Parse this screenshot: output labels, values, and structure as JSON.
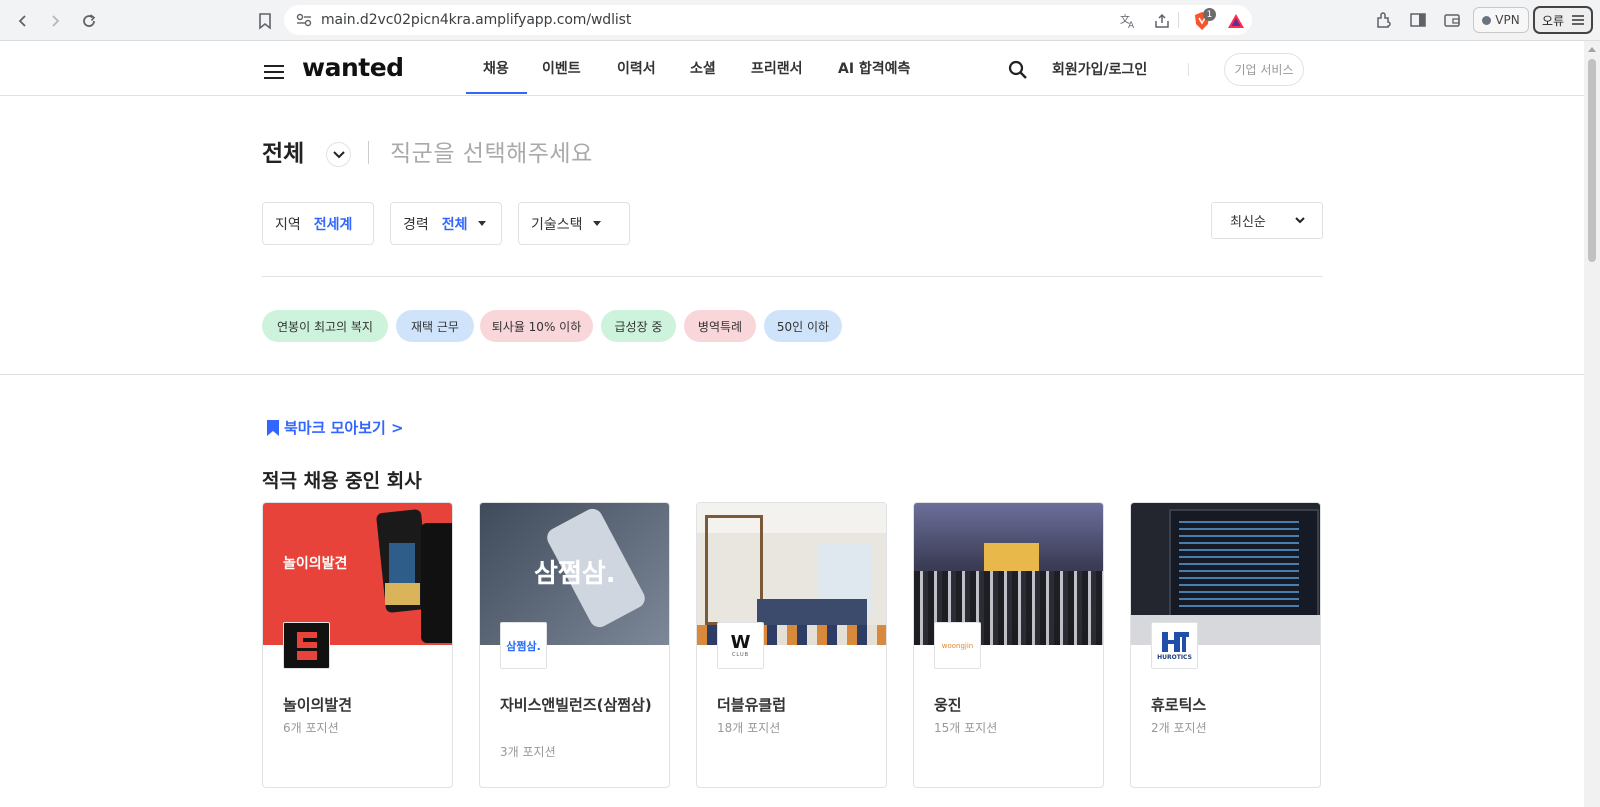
{
  "browser": {
    "url": "main.d2vc02picn4kra.amplifyapp.com/wdlist",
    "vpn_label": "VPN",
    "error_label": "오류",
    "brave_badge": "1"
  },
  "header": {
    "logo": "wanted",
    "nav": [
      "채용",
      "이벤트",
      "이력서",
      "소셜",
      "프리랜서",
      "AI 합격예측"
    ],
    "active_nav": "채용",
    "login": "회원가입/로그인",
    "biz_service": "기업 서비스"
  },
  "filters": {
    "category": "전체",
    "job_placeholder": "직군을 선택해주세요",
    "region_label": "지역",
    "region_value": "전세계",
    "career_label": "경력",
    "career_value": "전체",
    "tech_stack": "기술스택",
    "sort": "최신순",
    "tags": [
      {
        "label": "연봉이 최고의 복지",
        "color": "#cdf3dc"
      },
      {
        "label": "재택 근무",
        "color": "#cfe4fb"
      },
      {
        "label": "퇴사율 10% 이하",
        "color": "#f9d6d9"
      },
      {
        "label": "급성장 중",
        "color": "#cdf3dc"
      },
      {
        "label": "병역특례",
        "color": "#f9d6d9"
      },
      {
        "label": "50인 이하",
        "color": "#cfe4fb"
      }
    ]
  },
  "bookmark_link": "북마크 모아보기 >",
  "section_title": "적극 채용 중인 회사",
  "companies": [
    {
      "name": "놀이의발견",
      "positions": "6개 포지션",
      "hero_text": "놀이의발견",
      "hero_color": "#e8433b"
    },
    {
      "name": "자비스앤빌런즈(삼쩜삼)",
      "positions": "3개 포지션",
      "hero_text": "삼쩜삼.",
      "hero_color": "#5f6b7d"
    },
    {
      "name": "더블유클럽",
      "positions": "18개 포지션",
      "logo_text": "W",
      "logo_sub": "CLUB",
      "hero_color": "#d9d4cc"
    },
    {
      "name": "웅진",
      "positions": "15개 포지션",
      "logo_text": "woongjin",
      "hero_color": "#4b4e68"
    },
    {
      "name": "휴로틱스",
      "positions": "2개 포지션",
      "logo_text": "HUROTICS",
      "hero_color": "#2c3140"
    }
  ],
  "colors": {
    "accent": "#3366ff",
    "border": "#e1e2e3"
  }
}
